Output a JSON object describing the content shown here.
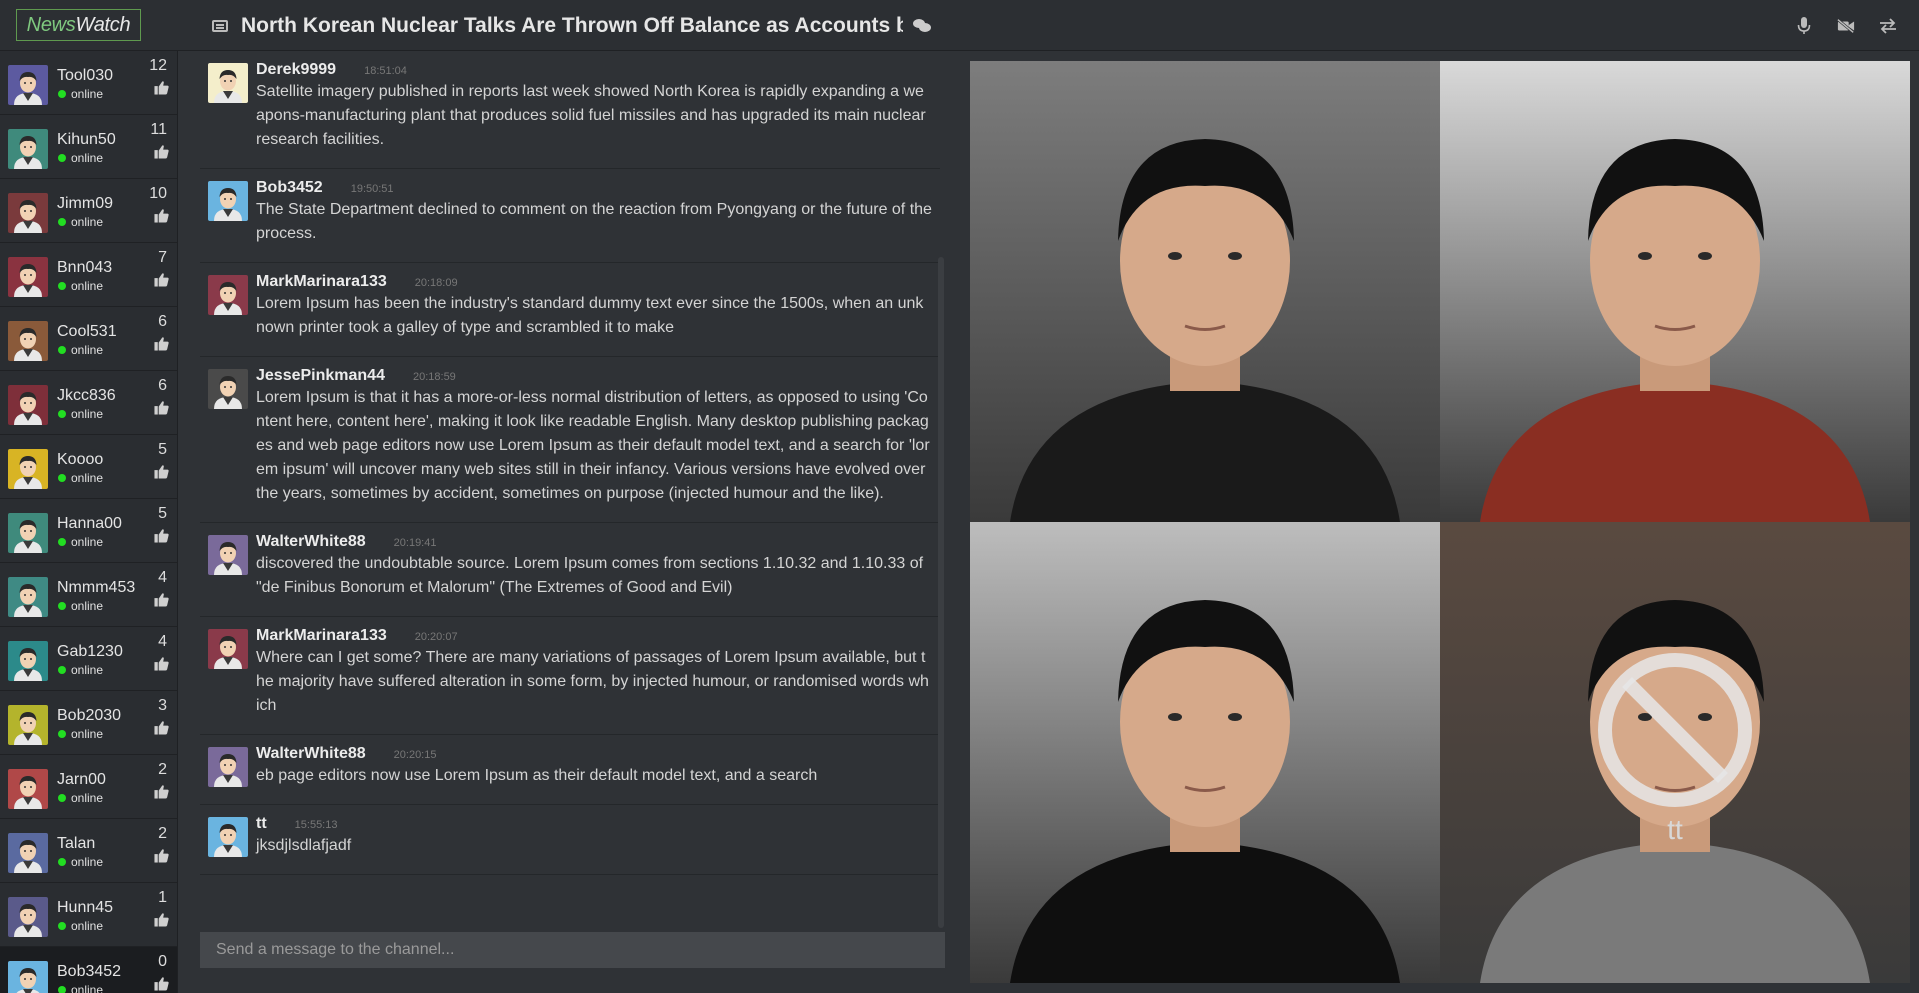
{
  "app": {
    "logo_part1": "News",
    "logo_part2": "Watch"
  },
  "header": {
    "title": "North Korean Nuclear Talks Are Thrown Off Balance as Accounts by"
  },
  "users": [
    {
      "name": "Tool030",
      "status": "online",
      "likes": "12",
      "color": "#5c5aa0"
    },
    {
      "name": "Kihun50",
      "status": "online",
      "likes": "11",
      "color": "#3f8a7c"
    },
    {
      "name": "Jimm09",
      "status": "online",
      "likes": "10",
      "color": "#7a3a3c"
    },
    {
      "name": "Bnn043",
      "status": "online",
      "likes": "7",
      "color": "#8a3340"
    },
    {
      "name": "Cool531",
      "status": "online",
      "likes": "6",
      "color": "#8a5a3a"
    },
    {
      "name": "Jkcc836",
      "status": "online",
      "likes": "6",
      "color": "#7e2f3a"
    },
    {
      "name": "Koooo",
      "status": "online",
      "likes": "5",
      "color": "#d8b424"
    },
    {
      "name": "Hanna00",
      "status": "online",
      "likes": "5",
      "color": "#3f8a7c"
    },
    {
      "name": "Nmmm453",
      "status": "online",
      "likes": "4",
      "color": "#3f8a84"
    },
    {
      "name": "Gab1230",
      "status": "online",
      "likes": "4",
      "color": "#2c8a8a"
    },
    {
      "name": "Bob2030",
      "status": "online",
      "likes": "3",
      "color": "#b4b42c"
    },
    {
      "name": "Jarn00",
      "status": "online",
      "likes": "2",
      "color": "#b04848"
    },
    {
      "name": "Talan",
      "status": "online",
      "likes": "2",
      "color": "#5a6aa0"
    },
    {
      "name": "Hunn45",
      "status": "online",
      "likes": "1",
      "color": "#5a5a8a"
    },
    {
      "name": "Bob3452",
      "status": "online",
      "likes": "0",
      "color": "#6ab4e0"
    }
  ],
  "messages": [
    {
      "author": "Derek9999",
      "time": "18:51:04",
      "text": "Satellite imagery published in reports last week showed North Korea is rapidly expanding a weapons-manufacturing plant that produces solid fuel missiles and has upgraded its main nuclear research facilities.",
      "color": "#f4eecb"
    },
    {
      "author": "Bob3452",
      "time": "19:50:51",
      "text": "The State Department declined to comment on the reaction from Pyongyang or the future of the process.",
      "color": "#6ab4e0"
    },
    {
      "author": "MarkMarinara133",
      "time": "20:18:09",
      "text": "Lorem Ipsum has been the industry's standard dummy text ever since the 1500s, when an unknown printer took a galley of type and scrambled it to make",
      "color": "#8a3a4a"
    },
    {
      "author": "JessePinkman44",
      "time": "20:18:59",
      "text": "Lorem Ipsum is that it has a more-or-less normal distribution of letters, as opposed to using 'Content here, content here', making it look like readable English. Many desktop publishing packages and web page editors now use Lorem Ipsum as their default model text, and a search for 'lorem ipsum' will uncover many web sites still in their infancy. Various versions have evolved over the years, sometimes by accident, sometimes on purpose (injected humour and the like).",
      "color": "#4a4a4a"
    },
    {
      "author": "WalterWhite88",
      "time": "20:19:41",
      "text": "discovered the undoubtable source. Lorem Ipsum comes from sections 1.10.32 and 1.10.33 of \"de Finibus Bonorum et Malorum\" (The Extremes of Good and Evil)",
      "color": "#7a6a9a"
    },
    {
      "author": "MarkMarinara133",
      "time": "20:20:07",
      "text": "Where can I get some? There are many variations of passages of Lorem Ipsum available, but the majority have suffered alteration in some form, by injected humour, or randomised words which",
      "color": "#8a3a4a"
    },
    {
      "author": "WalterWhite88",
      "time": "20:20:15",
      "text": "eb page editors now use Lorem Ipsum as their default model text, and a search",
      "color": "#7a6a9a"
    },
    {
      "author": "tt",
      "time": "15:55:13",
      "text": "jksdjlsdlafjadf",
      "color": "#6ab4e0"
    }
  ],
  "composer": {
    "placeholder": "Send a message to the channel..."
  },
  "videos": [
    {
      "shirt": "#1a1a1a",
      "bg": "#7d7d7d",
      "muted": false
    },
    {
      "shirt": "#8a2e22",
      "bg": "#d9d9d9",
      "muted": false
    },
    {
      "shirt": "#0f0f0f",
      "bg": "#bdbdbd",
      "muted": false
    },
    {
      "shirt": "#7a7a7a",
      "bg": "#5a4a40",
      "muted": true,
      "label": "tt"
    }
  ]
}
